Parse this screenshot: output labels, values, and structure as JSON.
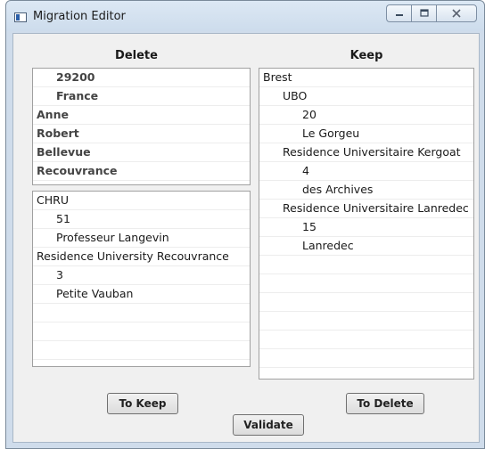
{
  "window": {
    "title": "Migration Editor"
  },
  "delete_panel": {
    "title": "Delete",
    "top_list": [
      {
        "text": "29200",
        "indent": 1,
        "bold": true
      },
      {
        "text": "France",
        "indent": 1,
        "bold": true
      },
      {
        "text": "Anne",
        "indent": 0,
        "bold": true
      },
      {
        "text": "Robert",
        "indent": 0,
        "bold": true
      },
      {
        "text": "Bellevue",
        "indent": 0,
        "bold": true
      },
      {
        "text": "Recouvrance",
        "indent": 0,
        "bold": true
      }
    ],
    "bottom_list": [
      {
        "text": "CHRU",
        "indent": 0,
        "bold": false
      },
      {
        "text": "51",
        "indent": 1,
        "bold": false
      },
      {
        "text": "Professeur Langevin",
        "indent": 1,
        "bold": false
      },
      {
        "text": "Residence University Recouvrance",
        "indent": 0,
        "bold": false
      },
      {
        "text": "3",
        "indent": 1,
        "bold": false
      },
      {
        "text": "Petite Vauban",
        "indent": 1,
        "bold": false
      },
      {
        "text": "",
        "indent": 0,
        "bold": false
      },
      {
        "text": "",
        "indent": 0,
        "bold": false
      },
      {
        "text": "",
        "indent": 0,
        "bold": false
      }
    ]
  },
  "keep_panel": {
    "title": "Keep",
    "list": [
      {
        "text": "Brest",
        "indent": 0,
        "bold": false
      },
      {
        "text": "UBO",
        "indent": 1,
        "bold": false
      },
      {
        "text": "20",
        "indent": 2,
        "bold": false
      },
      {
        "text": "Le Gorgeu",
        "indent": 2,
        "bold": false
      },
      {
        "text": "Residence Universitaire Kergoat",
        "indent": 1,
        "bold": false
      },
      {
        "text": "4",
        "indent": 2,
        "bold": false
      },
      {
        "text": "des Archives",
        "indent": 2,
        "bold": false
      },
      {
        "text": "Residence Universitaire Lanredec",
        "indent": 1,
        "bold": false
      },
      {
        "text": "15",
        "indent": 2,
        "bold": false
      },
      {
        "text": "Lanredec",
        "indent": 2,
        "bold": false
      },
      {
        "text": "",
        "indent": 0,
        "bold": false
      },
      {
        "text": "",
        "indent": 0,
        "bold": false
      },
      {
        "text": "",
        "indent": 0,
        "bold": false
      },
      {
        "text": "",
        "indent": 0,
        "bold": false
      },
      {
        "text": "",
        "indent": 0,
        "bold": false
      },
      {
        "text": "",
        "indent": 0,
        "bold": false
      }
    ]
  },
  "buttons": {
    "to_keep": "To Keep",
    "to_delete": "To Delete",
    "validate": "Validate"
  },
  "icons": {
    "minimize": "minimize-icon",
    "maximize": "maximize-icon",
    "close": "close-icon"
  }
}
